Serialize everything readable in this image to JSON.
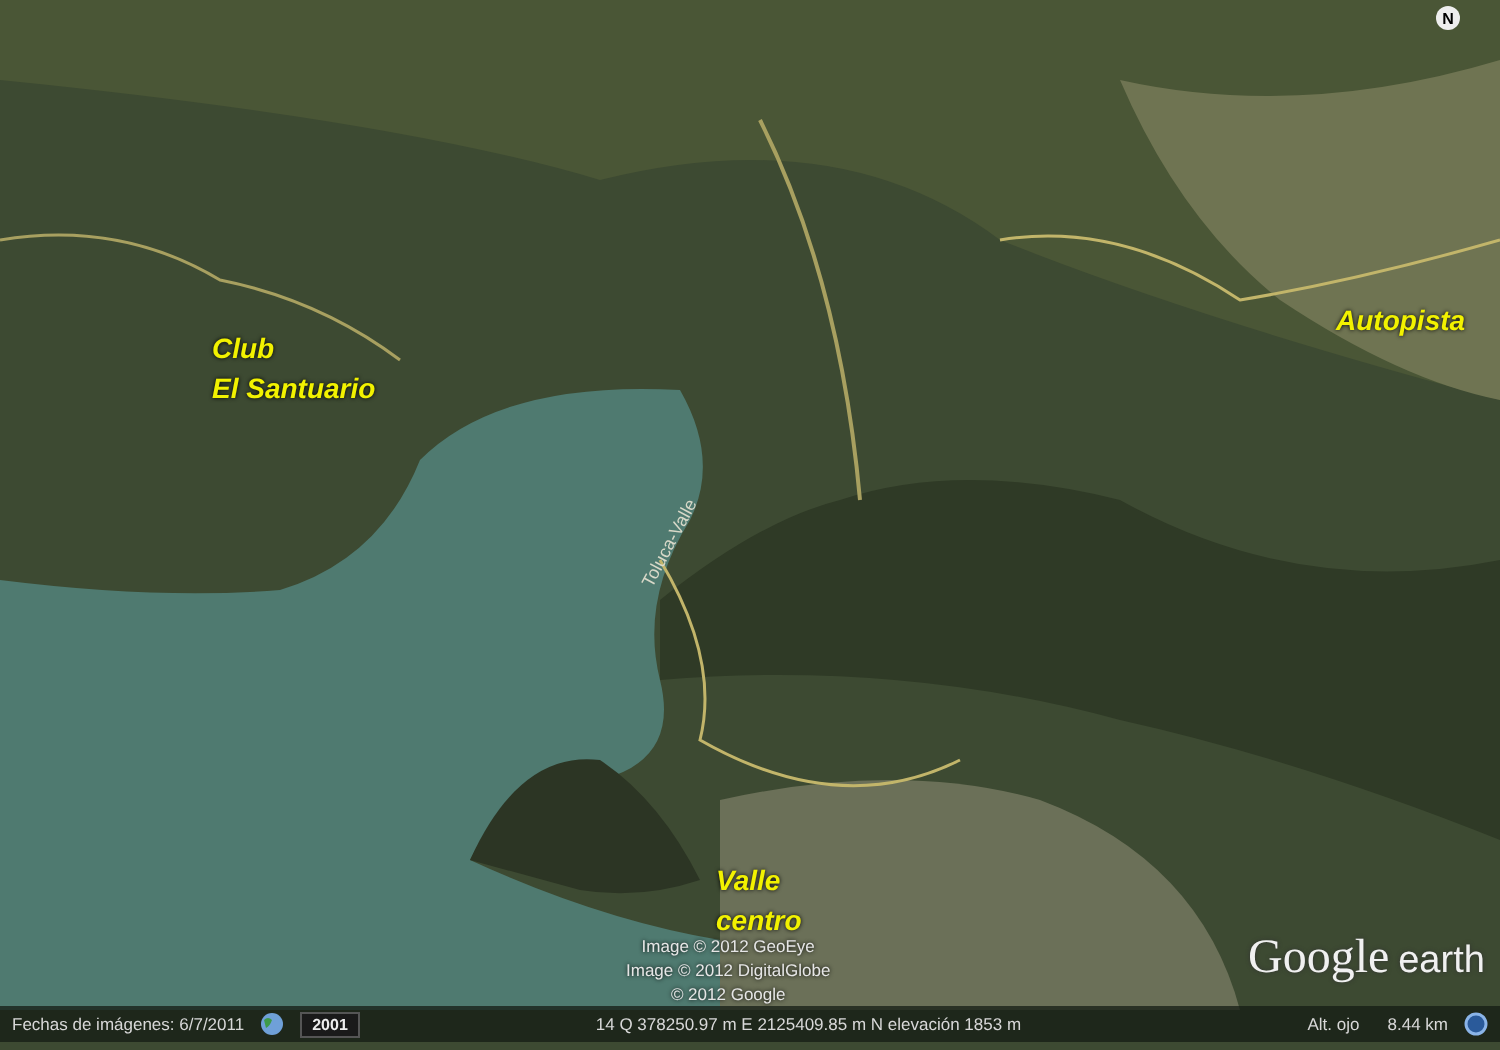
{
  "map": {
    "labels": [
      {
        "text": "Club\nEl Santuario",
        "kind": "place"
      },
      {
        "text": "Autopista",
        "kind": "place"
      },
      {
        "text": "Valle\ncentro",
        "kind": "place"
      },
      {
        "text": "Toluca-Valle",
        "kind": "road"
      }
    ],
    "compass": "N",
    "attribution": [
      "Image © 2012 GeoEye",
      "Image © 2012 DigitalGlobe",
      "© 2012 Google"
    ],
    "logo": {
      "brand": "Google",
      "product": "earth"
    }
  },
  "status_bar": {
    "imagery_date": "Fechas de imágenes: 6/7/2011",
    "year": "2001",
    "coordinates": "14 Q 378250.97 m E 2125409.85 m N elevación  1853 m",
    "eye_alt_label": "Alt. ojo",
    "eye_alt": "8.44 km"
  }
}
